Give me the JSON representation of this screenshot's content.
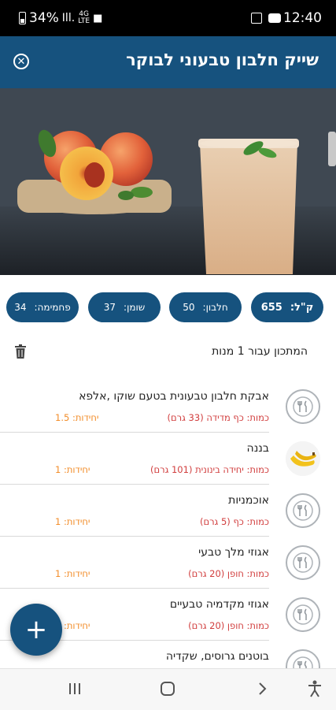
{
  "status_bar": {
    "battery_percent": "34%",
    "network": "4G",
    "network_sub": "LTE",
    "time": "12:40"
  },
  "header": {
    "title": "שייק חלבון טבעוני לבוקר",
    "color": "#16527e"
  },
  "hero": {
    "description_icon": "smoothie-photo"
  },
  "nutrition": {
    "calories": {
      "label": "ק\"ל:",
      "value": "655"
    },
    "protein": {
      "label": "חלבון:",
      "value": "50"
    },
    "fat": {
      "label": "שומן:",
      "value": "37"
    },
    "carbs": {
      "label": "פחמימה:",
      "value": "34"
    }
  },
  "recipe": {
    "servings_text": "המתכון עבור 1 מנות",
    "ingredients": [
      {
        "name": "אבקת חלבון טבעונית בטעם שוקו ,אלפא",
        "quantity": "כמות: כף מדידה (33 גרם)",
        "units": "יחידות: 1.5",
        "icon": "fork-knife-icon"
      },
      {
        "name": "בננה",
        "quantity": "כמות: יחידה בינונית (101 גרם)",
        "units": "יחידות: 1",
        "icon": "banana-photo"
      },
      {
        "name": "אוכמניות",
        "quantity": "כמות: כף (5 גרם)",
        "units": "יחידות: 1",
        "icon": "fork-knife-icon"
      },
      {
        "name": "אגוזי מלך טבעי",
        "quantity": "כמות: חופן (20 גרם)",
        "units": "יחידות: 1",
        "icon": "fork-knife-icon"
      },
      {
        "name": "אגוזי מקדמיה טבעיים",
        "quantity": "כמות: חופן (20 גרם)",
        "units": "יחידות: 1",
        "icon": "fork-knife-icon"
      },
      {
        "name": "בוטנים גרוסים, שקדיה",
        "quantity": "",
        "units": "",
        "icon": "fork-knife-icon"
      }
    ]
  },
  "fab": {
    "label": "+"
  },
  "colors": {
    "quantity": "#d13d3d",
    "units": "#f28c28",
    "primary": "#16527e"
  }
}
